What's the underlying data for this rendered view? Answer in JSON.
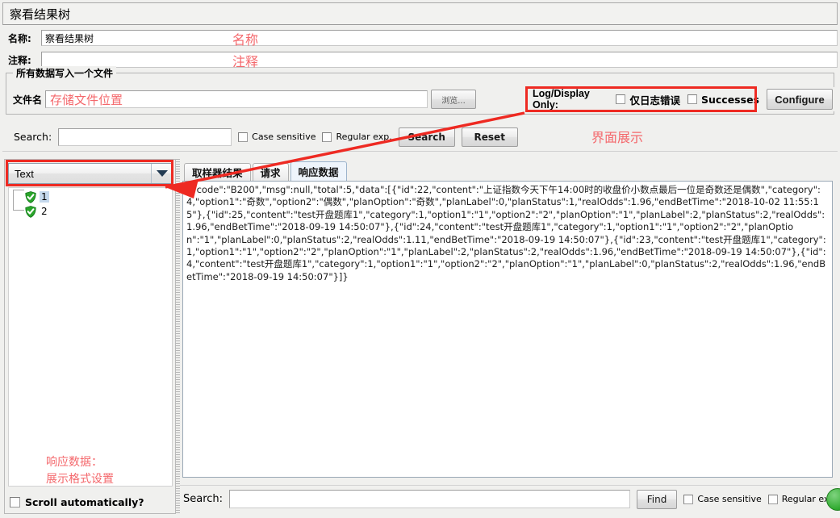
{
  "window": {
    "title": "察看结果树"
  },
  "fields": {
    "name_label": "名称:",
    "name_value": "察看结果树",
    "comment_label": "注释:",
    "comment_value": ""
  },
  "file_group": {
    "title": "所有数据写入一个文件",
    "filename_label": "文件名",
    "filename_value": "存储文件位置",
    "browse_button": "浏览..."
  },
  "log_display": {
    "title": "Log/Display Only:",
    "errors_checkbox": "仅日志错误",
    "errors_checked": false,
    "successes_checkbox": "Successes",
    "successes_checked": false,
    "configure_button": "Configure"
  },
  "top_search": {
    "label": "Search:",
    "value": "",
    "case_sensitive": "Case sensitive",
    "case_sensitive_checked": false,
    "regular_exp": "Regular exp.",
    "regular_exp_checked": false,
    "search_button": "Search",
    "reset_button": "Reset"
  },
  "left_pane": {
    "renderer_selected": "Text",
    "tree_items": [
      {
        "label": "1",
        "selected": true,
        "icon": "green-shield-check-icon"
      },
      {
        "label": "2",
        "selected": false,
        "icon": "green-shield-check-icon"
      }
    ],
    "scroll_auto_label": "Scroll automatically?",
    "scroll_auto_checked": false
  },
  "right_pane": {
    "tabs": [
      {
        "label": "取样器结果",
        "active": false
      },
      {
        "label": "请求",
        "active": false
      },
      {
        "label": "响应数据",
        "active": true
      }
    ],
    "response_text": "{\"code\":\"B200\",\"msg\":null,\"total\":5,\"data\":[{\"id\":22,\"content\":\"上证指数今天下午14:00时的收盘价小数点最后一位是奇数还是偶数\",\"category\":4,\"option1\":\"奇数\",\"option2\":\"偶数\",\"planOption\":\"奇数\",\"planLabel\":0,\"planStatus\":1,\"realOdds\":1.96,\"endBetTime\":\"2018-10-02 11:55:15\"},{\"id\":25,\"content\":\"test开盘题库1\",\"category\":1,\"option1\":\"1\",\"option2\":\"2\",\"planOption\":\"1\",\"planLabel\":2,\"planStatus\":2,\"realOdds\":1.96,\"endBetTime\":\"2018-09-19 14:50:07\"},{\"id\":24,\"content\":\"test开盘题库1\",\"category\":1,\"option1\":\"1\",\"option2\":\"2\",\"planOption\":\"1\",\"planLabel\":0,\"planStatus\":2,\"realOdds\":1.11,\"endBetTime\":\"2018-09-19 14:50:07\"},{\"id\":23,\"content\":\"test开盘题库1\",\"category\":1,\"option1\":\"1\",\"option2\":\"2\",\"planOption\":\"1\",\"planLabel\":2,\"planStatus\":2,\"realOdds\":1.96,\"endBetTime\":\"2018-09-19 14:50:07\"},{\"id\":4,\"content\":\"test开盘题库1\",\"category\":1,\"option1\":\"1\",\"option2\":\"2\",\"planOption\":\"1\",\"planLabel\":0,\"planStatus\":2,\"realOdds\":1.96,\"endBetTime\":\"2018-09-19 14:50:07\"}]}",
    "bottom_search": {
      "label": "Search:",
      "value": "",
      "find_button": "Find",
      "case_sensitive": "Case sensitive",
      "case_sensitive_checked": false,
      "regular_exp": "Regular exp.",
      "regular_exp_checked": false
    }
  },
  "annotations": {
    "accent_color": "#f4686c",
    "highlight_color": "#ee2a22",
    "name_note": "名称",
    "comment_note": "注释",
    "ui_note": "界面展示",
    "response_note_line1": "响应数据：",
    "response_note_line2": "展示格式设置"
  }
}
